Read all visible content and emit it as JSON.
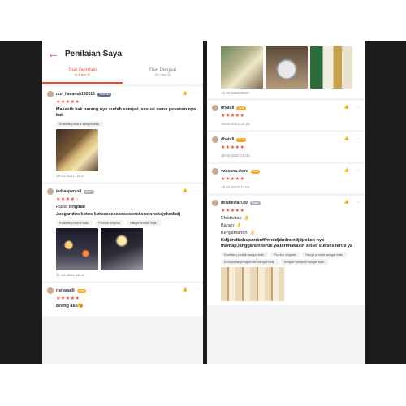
{
  "header": {
    "back_icon": "arrow-left-icon",
    "title": "Penilaian Saya"
  },
  "tabs": [
    {
      "label": "Dari Pembeli",
      "sub": "(4.9 dari 5)",
      "active": true
    },
    {
      "label": "Dari Penjual",
      "sub": "(5.0 dari 5)",
      "active": false
    }
  ],
  "colors": {
    "accent": "#ee4d2d",
    "gold_badge": "#f5a623",
    "silver_badge": "#a9b0bc",
    "platinum_badge": "#5b6b8c"
  },
  "left_reviews": [
    {
      "user": "nur_hasanah180513",
      "badge": "Platinum",
      "stars": 5,
      "text": "Makasih kak barang nya sudah sampai, sesuai sama pesanan nya kak",
      "chips": [
        "Kualitas produk sangat baik."
      ],
      "date": "19-12-2021 04:47"
    },
    {
      "user": "indraapanjoll",
      "badge": "Silver",
      "stars": 4,
      "rasa_label": "Rasa:",
      "rasa_value": "original",
      "text": "Josgandos kotos kotossssssssssssnsksnsjsnsksjsksdkdj",
      "chips": [
        "Kualitas produk baik.",
        "Produk original.",
        "Harga produk baik."
      ],
      "date": "17-12-2021 22:42"
    },
    {
      "user": "risnaradit",
      "badge": "Gold",
      "stars": 5,
      "text": "Brang asli😘"
    }
  ],
  "right_top": {
    "date": "15-02-2022 21:07"
  },
  "right_reviews": [
    {
      "user": "dhatull",
      "badge": "Gold",
      "stars": 5,
      "date": "15-02-2022 19:35"
    },
    {
      "user": "dhatull",
      "badge": "Gold",
      "stars": 5,
      "date": "15-02-2022 19:35"
    },
    {
      "user": "vancana.store",
      "badge": "Gold",
      "stars": 5,
      "date": "15-02-2022 17:04"
    },
    {
      "user": "dewilestari.89",
      "badge": "Silver",
      "stars": 5,
      "efek_label": "Efektivitas:",
      "bahan_label": "Bahan:",
      "nyaman_label": "Kenyamanan:",
      "emoji": "👌",
      "text": "Kdjjdndbchcjccnbnfffnnddjdndndndjdpokok nya mantap,langganan terus ya,terimakasih seller sukses terus ya",
      "chips": [
        "Kualitas produk sangat baik.",
        "Produk original.",
        "Harga produk sangat baik.",
        "Kecepatan pengiriman sangat baik.",
        "Respon penjual sangat baik."
      ]
    }
  ],
  "icons": {
    "like": "thumbs-up-icon",
    "more": "more-dots-icon",
    "star": "star-icon"
  }
}
